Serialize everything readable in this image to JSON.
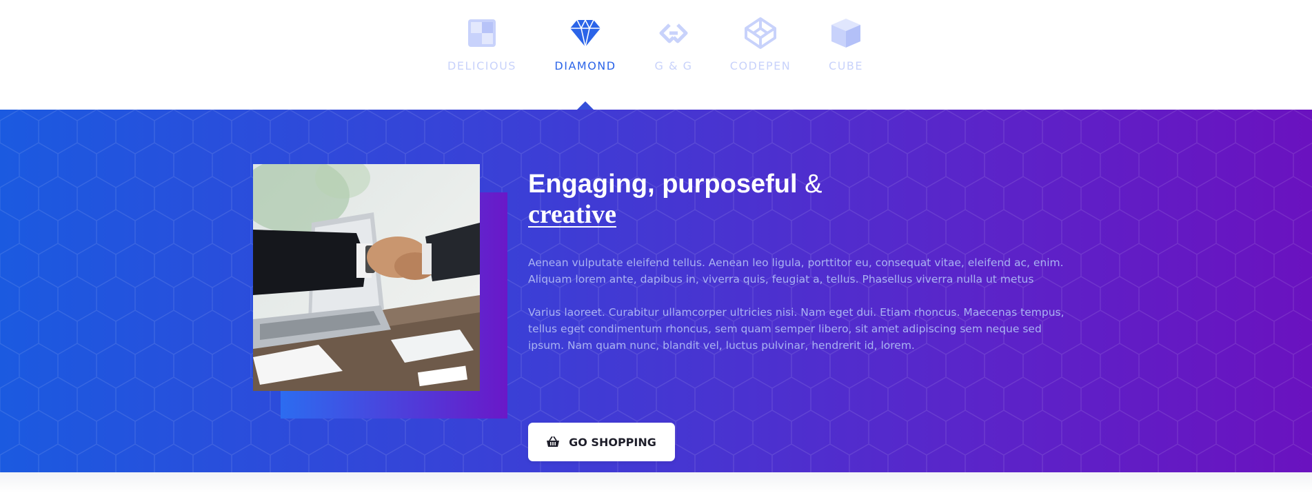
{
  "tabs": [
    {
      "label": "DELICIOUS",
      "icon": "delicious-icon",
      "active": false
    },
    {
      "label": "DIAMOND",
      "icon": "diamond-icon",
      "active": true
    },
    {
      "label": "G & G",
      "icon": "gg-icon",
      "active": false
    },
    {
      "label": "CODEPEN",
      "icon": "codepen-icon",
      "active": false
    },
    {
      "label": "CUBE",
      "icon": "cube-icon",
      "active": false
    }
  ],
  "hero": {
    "headline_main": "Engaging, purposeful",
    "headline_amp": "&",
    "headline_accent": "creative",
    "paragraph1": "Aenean vulputate eleifend tellus. Aenean leo ligula, porttitor eu, consequat vitae, eleifend ac, enim. Aliquam lorem ante, dapibus in, viverra quis, feugiat a, tellus. Phasellus viverra nulla ut metus",
    "paragraph2": "Varius laoreet. Curabitur ullamcorper ultricies nisi. Nam eget dui. Etiam rhoncus. Maecenas tempus, tellus eget condimentum rhoncus, sem quam semper libero, sit amet adipiscing sem neque sed ipsum. Nam quam nunc, blandit vel, luctus pulvinar, hendrerit id, lorem.",
    "button_label": "GO SHOPPING",
    "button_icon": "basket-icon",
    "photo": "handshake-photo"
  },
  "colors": {
    "accent": "#2b64e8",
    "tab_inactive": "#c8d2fb",
    "gradient_start": "#1b5ae0",
    "gradient_end": "#6a12bf",
    "body_text": "#aab3f2"
  }
}
